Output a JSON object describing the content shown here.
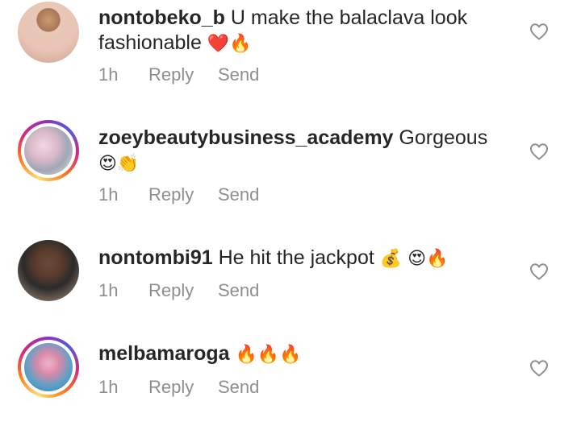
{
  "comments": [
    {
      "username": "nontobeko_b",
      "text": "U make the balaclava look fashionable",
      "emojis": "❤️🔥",
      "time": "1h",
      "reply_label": "Reply",
      "send_label": "Send",
      "avatar_ring": false
    },
    {
      "username": "zoeybeautybusiness_academy",
      "text": "Gorgeous",
      "emojis": "😍👏",
      "time": "1h",
      "reply_label": "Reply",
      "send_label": "Send",
      "avatar_ring": true
    },
    {
      "username": "nontombi91",
      "text": "He hit the jackpot",
      "emojis": "💰 😍🔥",
      "time": "1h",
      "reply_label": "Reply",
      "send_label": "Send",
      "avatar_ring": false
    },
    {
      "username": "melbamaroga",
      "text": "",
      "emojis": "🔥🔥🔥",
      "time": "1h",
      "reply_label": "Reply",
      "send_label": "Send",
      "avatar_ring": true
    }
  ],
  "icons": {
    "like": "heart-outline-icon"
  },
  "colors": {
    "text": "#262626",
    "meta": "#8e8e8e",
    "background": "#ffffff"
  }
}
